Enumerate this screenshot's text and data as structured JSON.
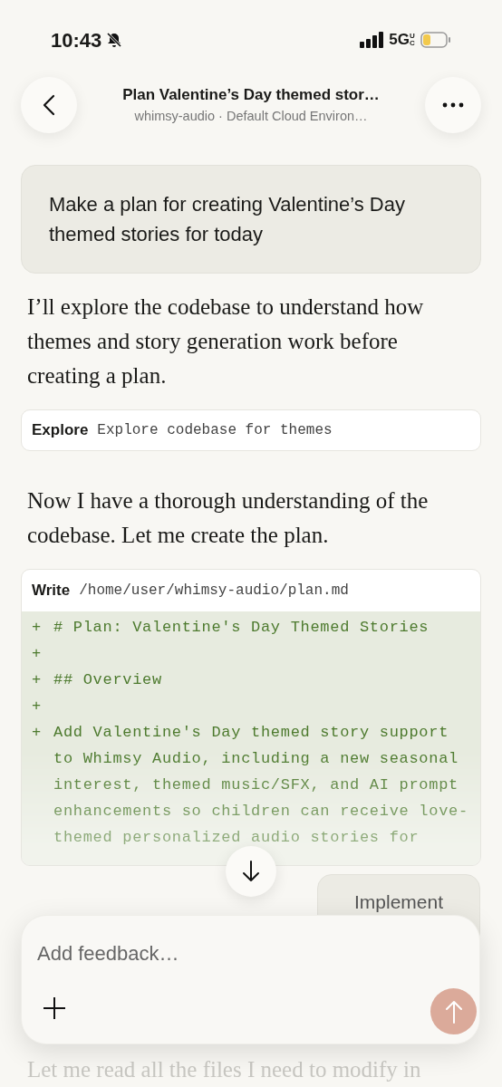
{
  "status_bar": {
    "time": "10:43",
    "network": "5G",
    "network_badge": "UC"
  },
  "header": {
    "title": "Plan Valentine’s Day themed stor…",
    "subtitle": "whimsy-audio · Default Cloud Environ…"
  },
  "messages": [
    {
      "kind": "user",
      "text": "Make a plan for creating Valentine’s Day themed stories for today"
    },
    {
      "kind": "assistant",
      "text": "I’ll explore the codebase to understand how themes and story generation work before creating a plan."
    },
    {
      "kind": "tool",
      "tool": "Explore",
      "detail": "Explore codebase for themes"
    },
    {
      "kind": "assistant",
      "text": "Now I have a thorough understanding of the codebase. Let me create the plan."
    },
    {
      "kind": "diff",
      "tool": "Write",
      "detail": "/home/user/whimsy-audio/plan.md",
      "lines": [
        {
          "sign": "+",
          "text": "# Plan: Valentine's Day Themed Stories"
        },
        {
          "sign": "+"
        },
        {
          "sign": "+",
          "text": "## Overview"
        },
        {
          "sign": "+"
        },
        {
          "sign": "+",
          "text": "Add Valentine's Day themed story support to Whimsy Audio, including a new seasonal interest, themed music/SFX, and AI prompt enhancements so children can receive love-themed personalized audio stories for"
        }
      ]
    }
  ],
  "pending_message": "Implement",
  "trailing_text": "Let me read all the files I need to modify in",
  "composer": {
    "placeholder": "Add feedback…"
  }
}
